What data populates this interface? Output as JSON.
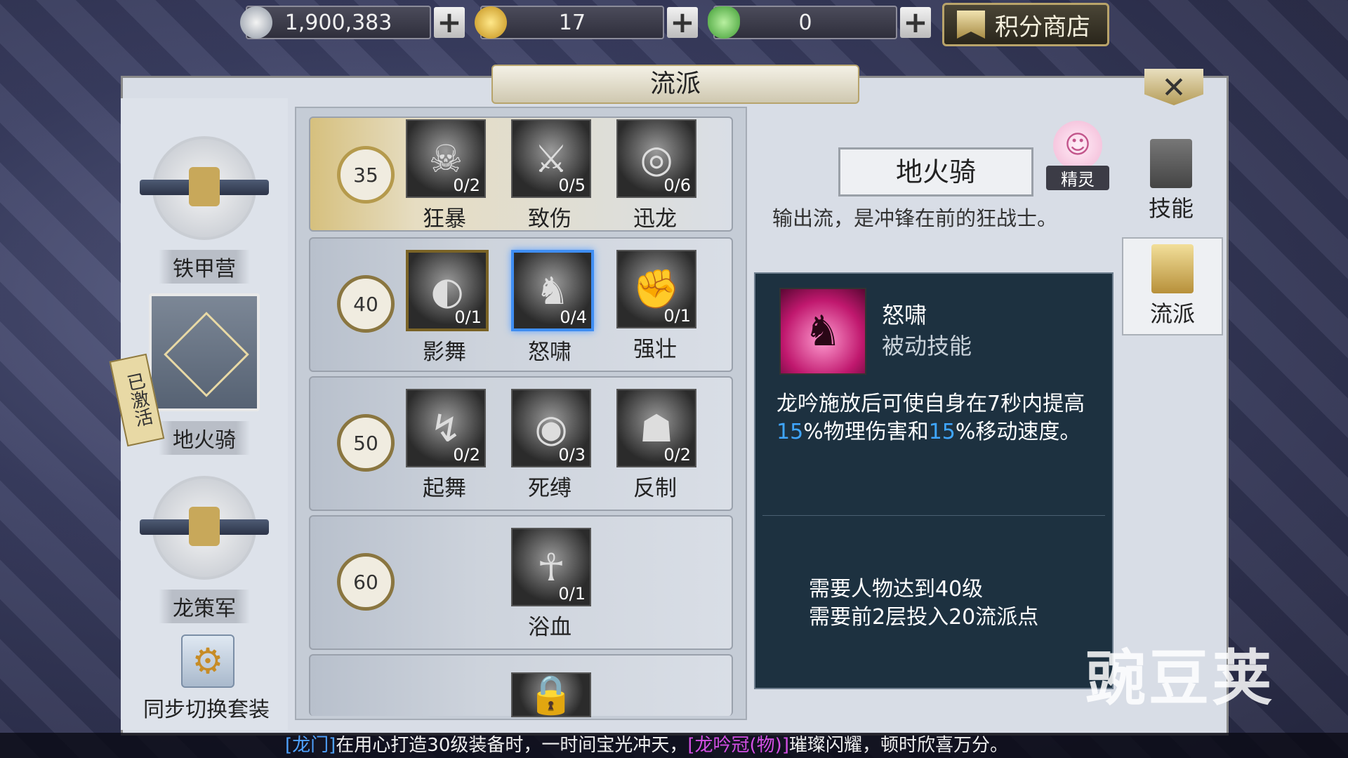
{
  "currency": {
    "silver": "1,900,383",
    "gold": "17",
    "ingot": "0"
  },
  "shop_label": "积分商店",
  "panel_title": "流派",
  "factions": [
    {
      "label": "铁甲营",
      "state": "inactive"
    },
    {
      "label": "地火骑",
      "state": "active",
      "badge": "已激活"
    },
    {
      "label": "龙策军",
      "state": "inactive"
    }
  ],
  "sync_label": "同步切换套装",
  "tiers": [
    {
      "level": "35",
      "skills": [
        {
          "name": "狂暴",
          "count": "0/2"
        },
        {
          "name": "致伤",
          "count": "0/5"
        },
        {
          "name": "迅龙",
          "count": "0/6"
        }
      ]
    },
    {
      "level": "40",
      "skills": [
        {
          "name": "影舞",
          "count": "0/1"
        },
        {
          "name": "怒啸",
          "count": "0/4",
          "selected": true
        },
        {
          "name": "强壮",
          "count": "0/1"
        }
      ]
    },
    {
      "level": "50",
      "skills": [
        {
          "name": "起舞",
          "count": "0/2"
        },
        {
          "name": "死缚",
          "count": "0/3"
        },
        {
          "name": "反制",
          "count": "0/2"
        }
      ]
    },
    {
      "level": "60",
      "skills": [
        {
          "name": "浴血",
          "count": "0/1"
        }
      ]
    }
  ],
  "detail": {
    "faction_name": "地火骑",
    "spirit_label": "精灵",
    "description": "输出流，是冲锋在前的狂战士。",
    "skill_name": "怒啸",
    "skill_type": "被动技能",
    "text_1": "龙吟施放后可使自身在7秒内提高",
    "pct_1": "15",
    "text_2": "%物理伤害和",
    "pct_2": "15",
    "text_3": "%移动速度。",
    "req_1": "需要人物达到40级",
    "req_2": "需要前2层投入20流派点"
  },
  "tabs": [
    {
      "label": "技能",
      "active": false
    },
    {
      "label": "流派",
      "active": true
    }
  ],
  "ticker": {
    "part1": "[龙门]",
    "part2": "在用心打造30级装备时，一时间宝光冲天，",
    "part3": "[龙吟冠(物)]",
    "part4": "璀璨闪耀，顿时欣喜万分。"
  },
  "watermark": "豌豆荚",
  "colors": {
    "selected_border": "#3f8ef3",
    "highlight_number": "#3fa6ff",
    "info_panel": "#172b3a",
    "ticker_guild": "#4fa2ff",
    "ticker_item": "#d34fe4"
  }
}
